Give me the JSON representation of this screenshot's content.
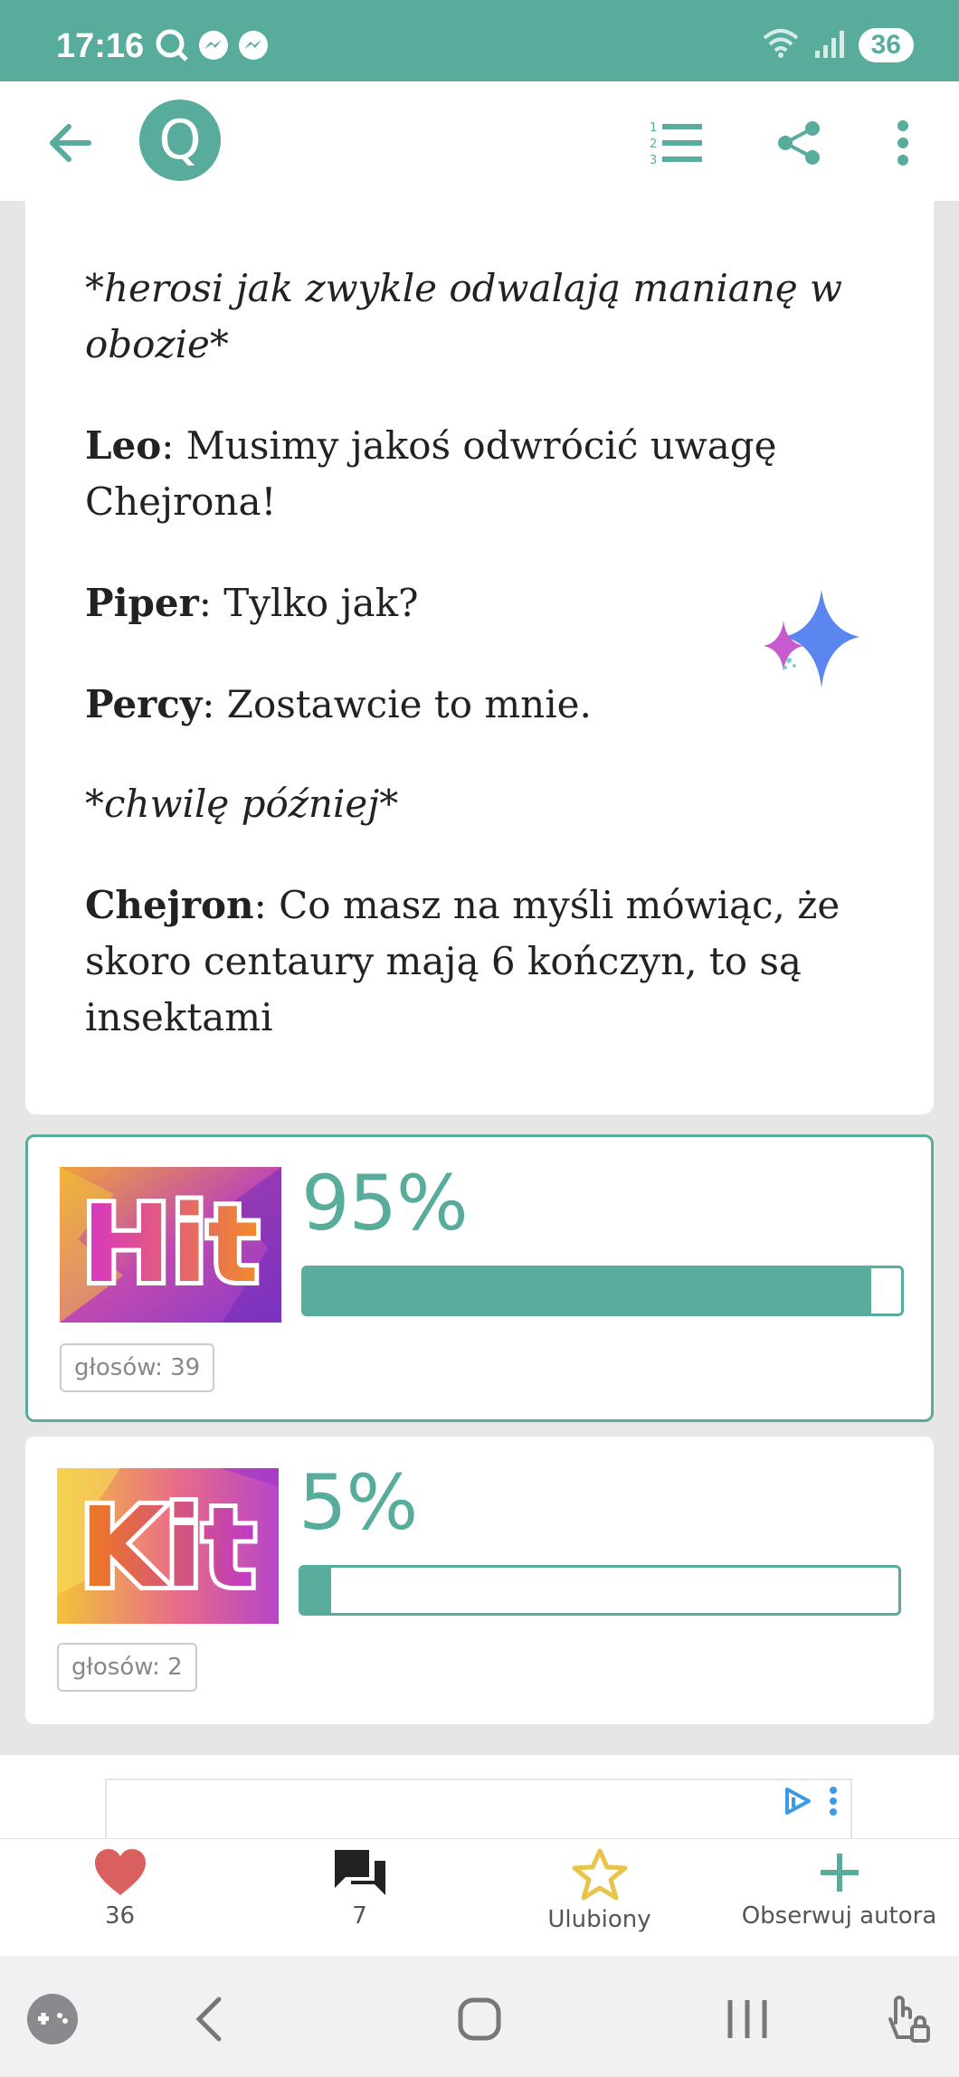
{
  "status_bar": {
    "time": "17:16",
    "battery": "36"
  },
  "app_bar": {
    "logo_letter": "Q"
  },
  "story": {
    "paragraphs": [
      {
        "italic": true,
        "speaker": "",
        "text": "*herosi jak zwykle odwalają manianę w obozie*"
      },
      {
        "italic": false,
        "speaker": "Leo",
        "text": ": Musimy jakoś odwrócić uwagę Chejrona!"
      },
      {
        "italic": false,
        "speaker": "Piper",
        "text": ": Tylko jak?"
      },
      {
        "italic": false,
        "speaker": "Percy",
        "text": ": Zostawcie to mnie."
      },
      {
        "italic": true,
        "speaker": "",
        "text": "*chwilę później*"
      },
      {
        "italic": false,
        "speaker": "Chejron",
        "text": ": Co masz na myśli mówiąc, że skoro centaury mają 6 kończyn, to są insektami"
      }
    ]
  },
  "poll": {
    "options": [
      {
        "image_text": "Hit",
        "percent_label": "95%",
        "percent": 95,
        "votes_label": "głosów: 39",
        "selected": true
      },
      {
        "image_text": "Kit",
        "percent_label": "5%",
        "percent": 5,
        "votes_label": "głosów: 2",
        "selected": false
      }
    ]
  },
  "actions": {
    "likes": "36",
    "comments": "7",
    "favorite": "Ulubiony",
    "follow": "Obserwuj autora"
  },
  "colors": {
    "accent": "#58ac9b",
    "heart": "#d9605f",
    "star": "#e8c44a"
  }
}
